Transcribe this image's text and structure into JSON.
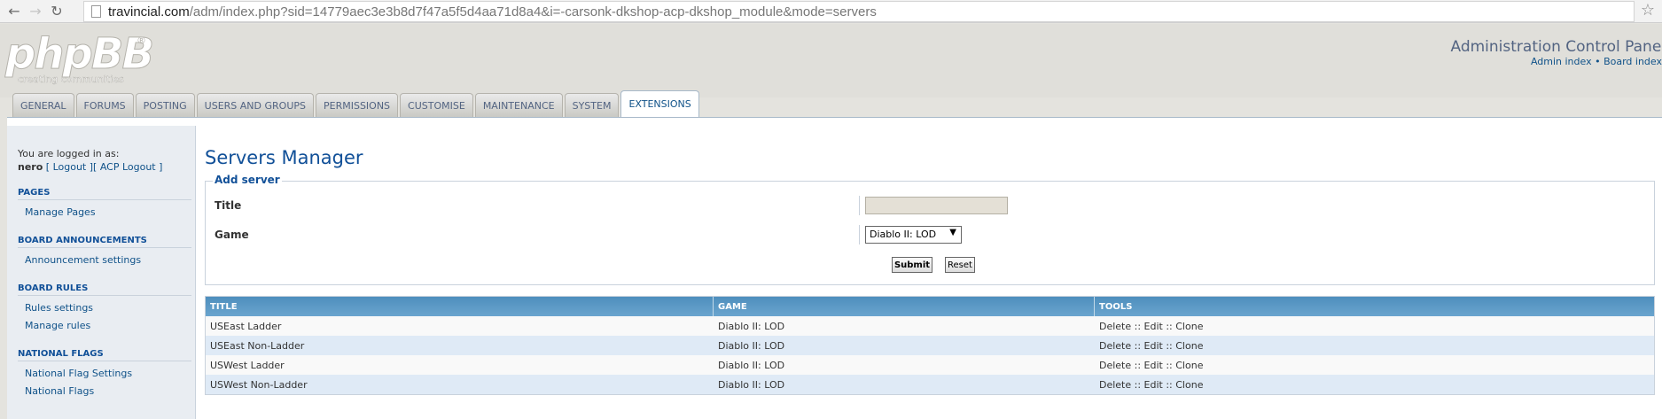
{
  "browser": {
    "url_host": "travincial.com",
    "url_path": "/adm/index.php?sid=14779aec3e3b8d7f47a5f5d4aa71d8a4&i=-carsonk-dkshop-acp-dkshop_module&mode=servers"
  },
  "header": {
    "logo_text": "phpBB",
    "logo_tagline": "creating   communities",
    "acp_title": "Administration Control Panel",
    "admin_index": "Admin index",
    "separator": " • ",
    "board_index": "Board index"
  },
  "tabs": [
    {
      "label": "GENERAL"
    },
    {
      "label": "FORUMS"
    },
    {
      "label": "POSTING"
    },
    {
      "label": "USERS AND GROUPS"
    },
    {
      "label": "PERMISSIONS"
    },
    {
      "label": "CUSTOMISE"
    },
    {
      "label": "MAINTENANCE"
    },
    {
      "label": "SYSTEM"
    },
    {
      "label": "EXTENSIONS"
    }
  ],
  "sidebar": {
    "logged_in_label": "You are logged in as:",
    "username": "nero",
    "logout": "[ Logout ]",
    "acp_logout": "[ ACP Logout ]",
    "sections": [
      {
        "title": "PAGES",
        "items": [
          "Manage Pages"
        ]
      },
      {
        "title": "BOARD ANNOUNCEMENTS",
        "items": [
          "Announcement settings"
        ]
      },
      {
        "title": "BOARD RULES",
        "items": [
          "Rules settings",
          "Manage rules"
        ]
      },
      {
        "title": "NATIONAL FLAGS",
        "items": [
          "National Flag Settings",
          "National Flags"
        ]
      }
    ]
  },
  "main": {
    "title": "Servers Manager",
    "form": {
      "legend": "Add server",
      "title_label": "Title",
      "title_value": "",
      "game_label": "Game",
      "game_selected": "Diablo II: LOD",
      "submit_label": "Submit",
      "reset_label": "Reset"
    },
    "table": {
      "headers": [
        "TITLE",
        "GAME",
        "TOOLS"
      ],
      "rows": [
        {
          "title": "USEast Ladder",
          "game": "Diablo II: LOD",
          "tools": "Delete :: Edit :: Clone"
        },
        {
          "title": "USEast Non-Ladder",
          "game": "Diablo II: LOD",
          "tools": "Delete :: Edit :: Clone"
        },
        {
          "title": "USWest Ladder",
          "game": "Diablo II: LOD",
          "tools": "Delete :: Edit :: Clone"
        },
        {
          "title": "USWest Non-Ladder",
          "game": "Diablo II: LOD",
          "tools": "Delete :: Edit :: Clone"
        }
      ]
    }
  },
  "colors": {
    "link": "#105289",
    "heading": "#115098",
    "table_header": "#5b9bc8",
    "row_alt": "#dfeaf6"
  }
}
